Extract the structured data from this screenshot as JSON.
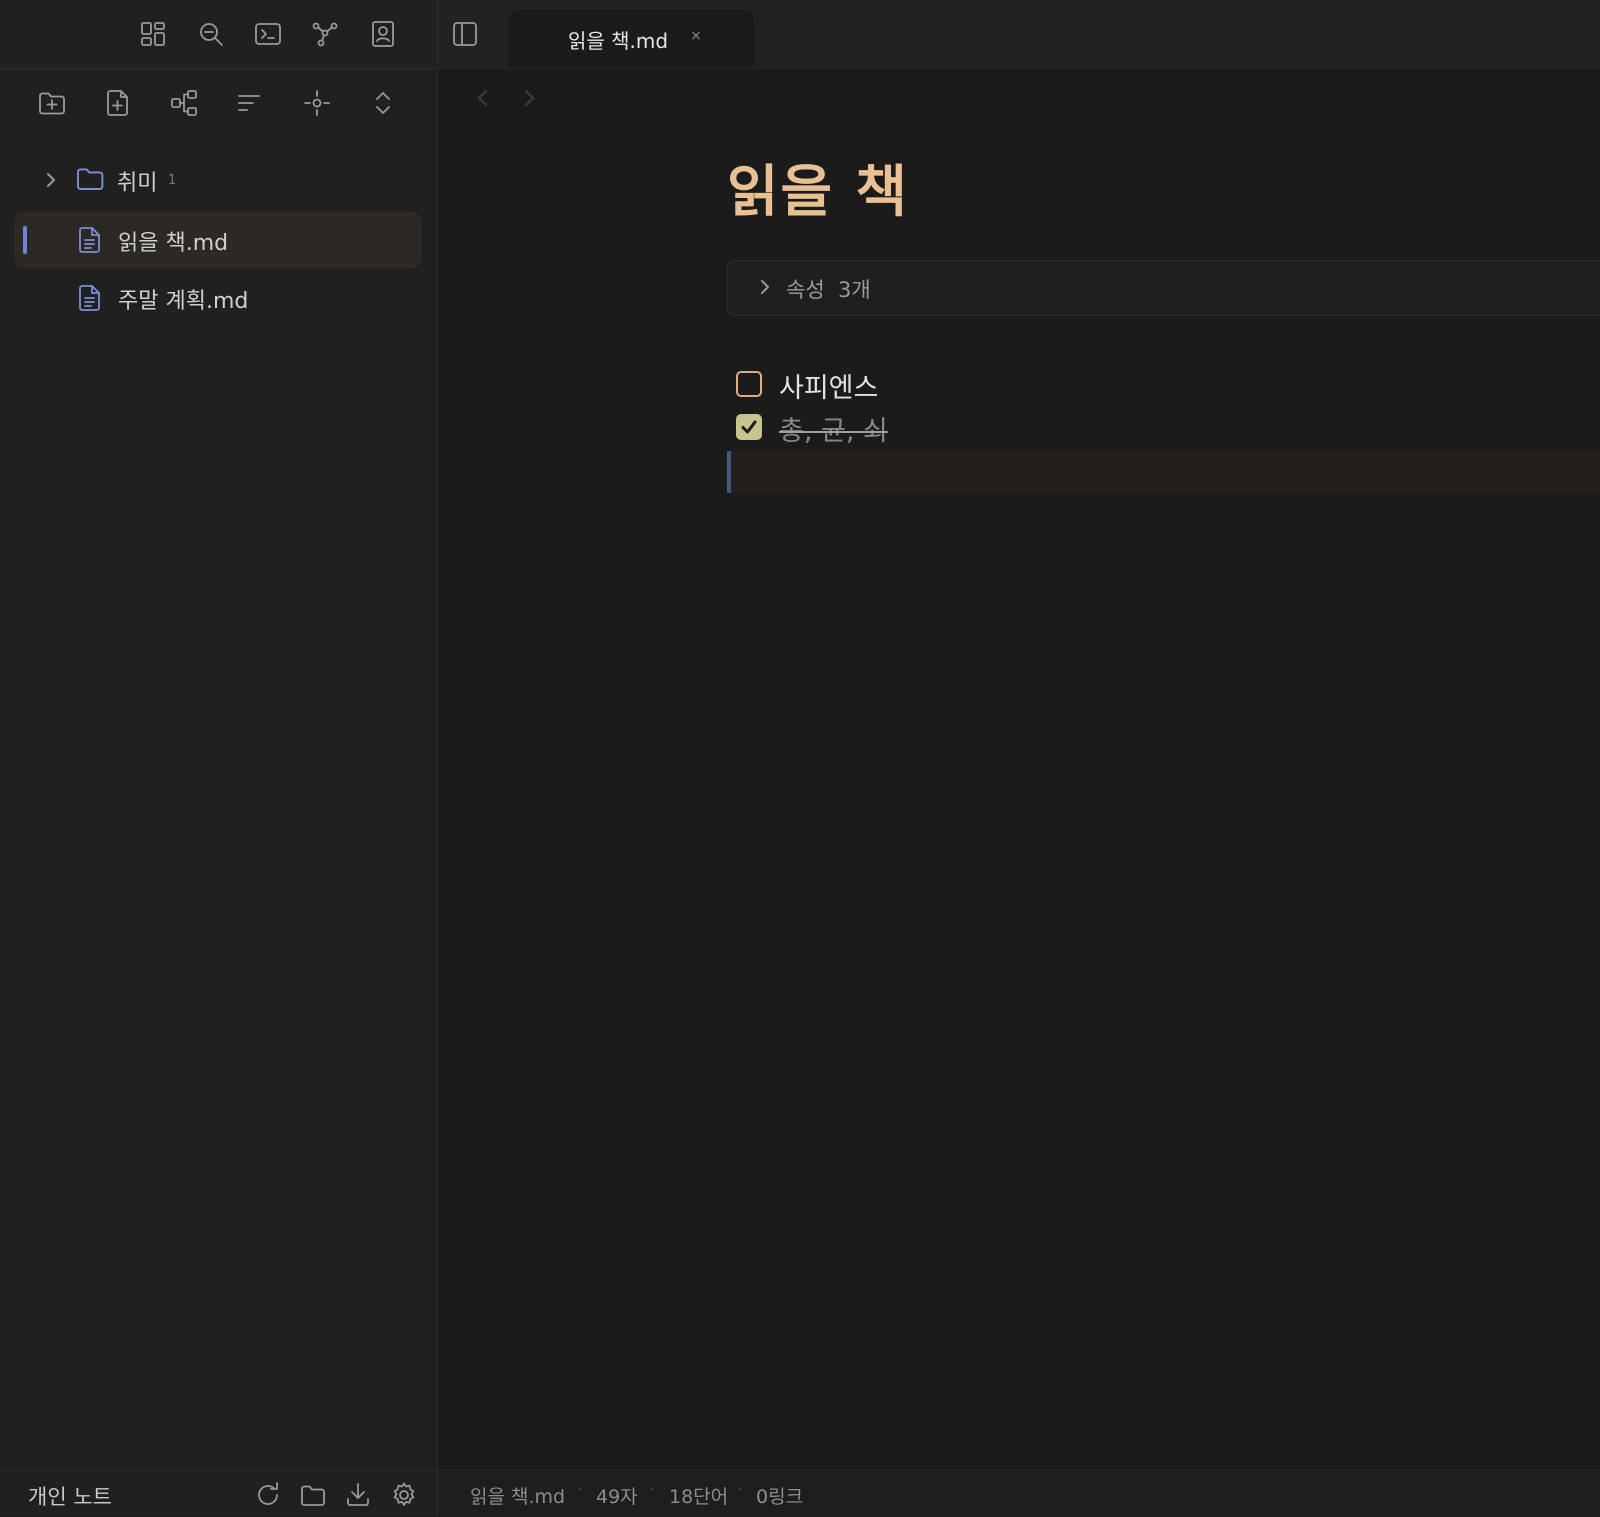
{
  "ribbon": {
    "icons": [
      "dashboard-icon",
      "search-icon",
      "terminal-icon",
      "graph-icon",
      "profile-icon"
    ]
  },
  "file_nav_toolbar": {
    "icons": [
      "new-folder-icon",
      "new-note-icon",
      "canvas-icon",
      "sort-icon",
      "locate-icon",
      "expand-collapse-icon"
    ]
  },
  "file_tree": {
    "folder": {
      "name": "취미",
      "count": "1"
    },
    "files": [
      {
        "name": "읽을 책.md",
        "active": true
      },
      {
        "name": "주말 계획.md",
        "active": false
      }
    ]
  },
  "sidebar_footer": {
    "vault_name": "개인 노트",
    "icons": [
      "sync-icon",
      "folder-icon",
      "download-icon",
      "settings-icon"
    ]
  },
  "tab": {
    "title": "읽을 책.md",
    "close": "×"
  },
  "note": {
    "title": "읽을 책",
    "properties_label": "속성  3개",
    "tasks": [
      {
        "text": "사피엔스",
        "checked": false
      },
      {
        "text": "총, 균, 쇠",
        "checked": true
      }
    ]
  },
  "status_bar": {
    "file": "읽을 책.md",
    "chars": "49자",
    "words": "18단어",
    "links": "0링크"
  },
  "colors": {
    "title": "#e9c094",
    "checkbox_border": "#e3ad83",
    "checkbox_checked": "#c8c490",
    "active_accent": "#6f86d8"
  }
}
